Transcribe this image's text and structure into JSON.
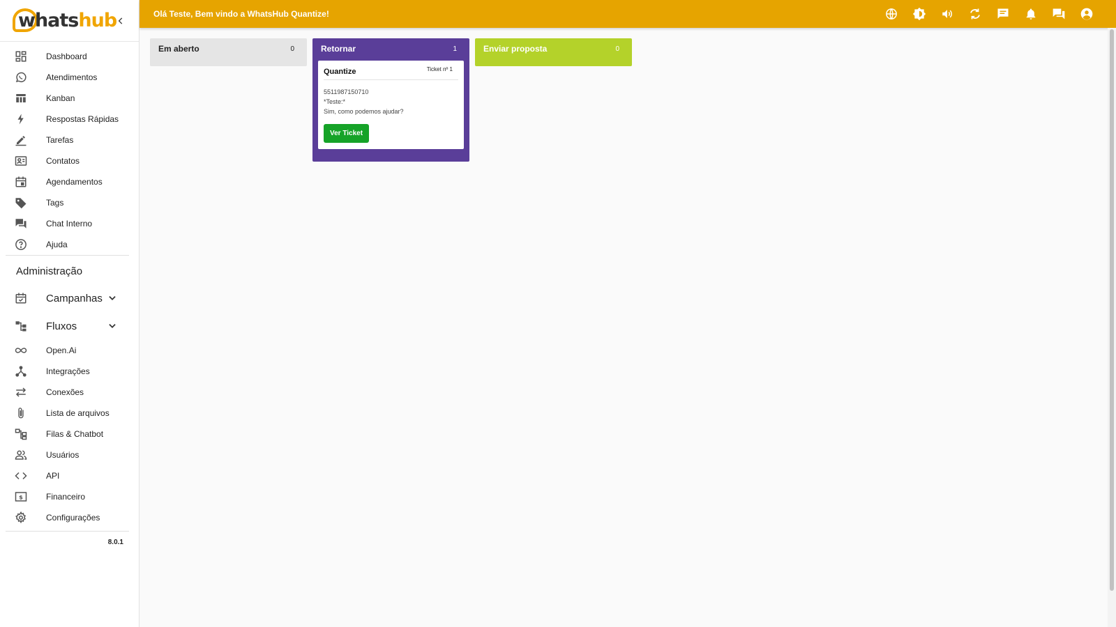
{
  "brand": {
    "logo_part1": "whats",
    "logo_part2": "hub",
    "accent": "#e6a400",
    "logo_color": "#f0a500"
  },
  "topbar": {
    "greeting": "Olá Teste, Bem vindo a WhatsHub Quantize!",
    "icons": [
      "globe-icon",
      "brightness-icon",
      "volume-icon",
      "refresh-icon",
      "message-icon",
      "bell-icon",
      "chat-icon",
      "account-icon"
    ]
  },
  "sidebar": {
    "items": [
      {
        "label": "Dashboard",
        "icon": "dashboard-icon"
      },
      {
        "label": "Atendimentos",
        "icon": "whatsapp-icon"
      },
      {
        "label": "Kanban",
        "icon": "kanban-icon"
      },
      {
        "label": "Respostas Rápidas",
        "icon": "flash-icon"
      },
      {
        "label": "Tarefas",
        "icon": "pencil-icon"
      },
      {
        "label": "Contatos",
        "icon": "contacts-icon"
      },
      {
        "label": "Agendamentos",
        "icon": "calendar-icon"
      },
      {
        "label": "Tags",
        "icon": "tag-icon"
      },
      {
        "label": "Chat Interno",
        "icon": "chat-icon"
      },
      {
        "label": "Ajuda",
        "icon": "help-icon"
      }
    ],
    "admin_title": "Administração",
    "admin_groups": [
      {
        "label": "Campanhas",
        "icon": "event-icon"
      },
      {
        "label": "Fluxos",
        "icon": "flow-icon"
      }
    ],
    "admin_items": [
      {
        "label": "Open.Ai",
        "icon": "infinity-icon"
      },
      {
        "label": "Integrações",
        "icon": "integration-icon"
      },
      {
        "label": "Conexões",
        "icon": "swap-icon"
      },
      {
        "label": "Lista de arquivos",
        "icon": "paperclip-icon"
      },
      {
        "label": "Filas & Chatbot",
        "icon": "queue-icon"
      },
      {
        "label": "Usuários",
        "icon": "users-icon"
      },
      {
        "label": "API",
        "icon": "code-icon"
      },
      {
        "label": "Financeiro",
        "icon": "money-icon"
      },
      {
        "label": "Configurações",
        "icon": "settings-icon"
      }
    ],
    "version": "8.0.1"
  },
  "board": {
    "lanes": [
      {
        "title": "Em aberto",
        "count": "0",
        "color": "#e5e5e5"
      },
      {
        "title": "Retornar",
        "count": "1",
        "color": "#5a3e99"
      },
      {
        "title": "Enviar proposta",
        "count": "0",
        "color": "#b4d22a"
      }
    ],
    "card": {
      "title": "Quantize",
      "ticket": "Ticket nº 1",
      "phone": "5511987150710",
      "line1": "*Teste:*",
      "line2": "Sim, como podemos ajudar?",
      "button": "Ver Ticket",
      "button_color": "#16a328"
    }
  }
}
